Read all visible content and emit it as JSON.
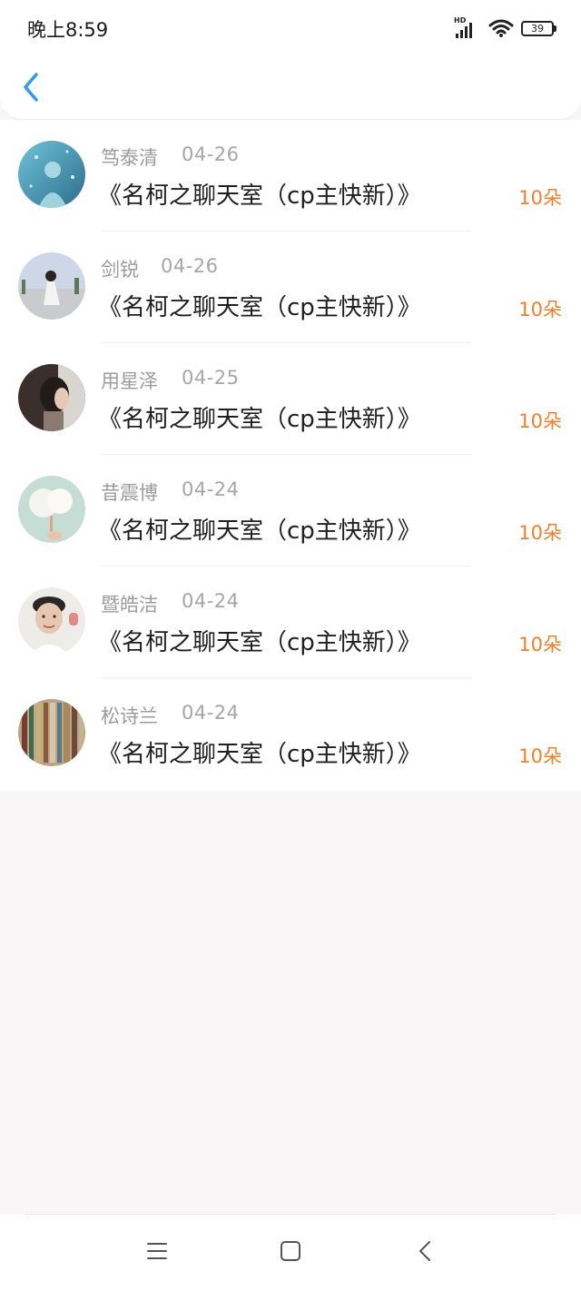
{
  "status_bar": {
    "time": "晚上8:59",
    "network_label": "HD",
    "battery": "39"
  },
  "header": {
    "back_icon": "chevron-left-icon",
    "accent_color": "#2f9af5"
  },
  "records": [
    {
      "user": "笃泰清",
      "date": "04-26",
      "title": "《名柯之聊天室（cp主快新）》",
      "amount": "10朵"
    },
    {
      "user": "剑锐",
      "date": "04-26",
      "title": "《名柯之聊天室（cp主快新）》",
      "amount": "10朵"
    },
    {
      "user": "用星泽",
      "date": "04-25",
      "title": "《名柯之聊天室（cp主快新）》",
      "amount": "10朵"
    },
    {
      "user": "昔震博",
      "date": "04-24",
      "title": "《名柯之聊天室（cp主快新）》",
      "amount": "10朵"
    },
    {
      "user": "暨皓洁",
      "date": "04-24",
      "title": "《名柯之聊天室（cp主快新）》",
      "amount": "10朵"
    },
    {
      "user": "松诗兰",
      "date": "04-24",
      "title": "《名柯之聊天室（cp主快新）》",
      "amount": "10朵"
    }
  ],
  "colors": {
    "amount": "#f0802b",
    "username": "#9c9c9c",
    "page_background": "#f8f6f7"
  },
  "navbar": {
    "icons": [
      "menu-icon",
      "home-square-icon",
      "back-icon"
    ]
  }
}
